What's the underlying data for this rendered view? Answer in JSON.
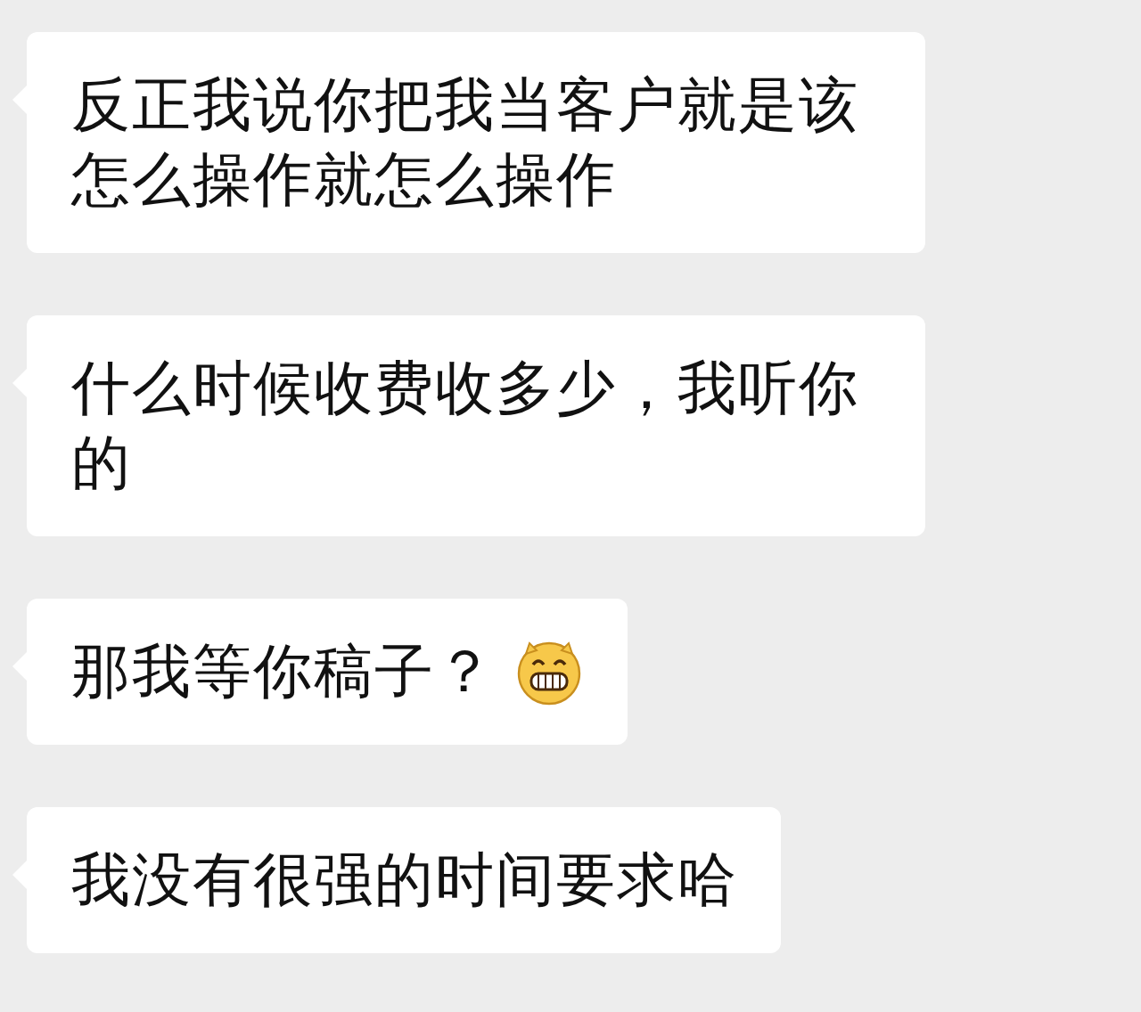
{
  "messages": [
    {
      "kind": "text",
      "text": "反正我说你把我当客户就是该怎么操作就怎么操作"
    },
    {
      "kind": "text",
      "text": "什么时候收费收多少，我听你的"
    },
    {
      "kind": "with_emoji",
      "text": "那我等你稿子？"
    },
    {
      "kind": "text",
      "text": "我没有很强的时间要求哈"
    }
  ]
}
